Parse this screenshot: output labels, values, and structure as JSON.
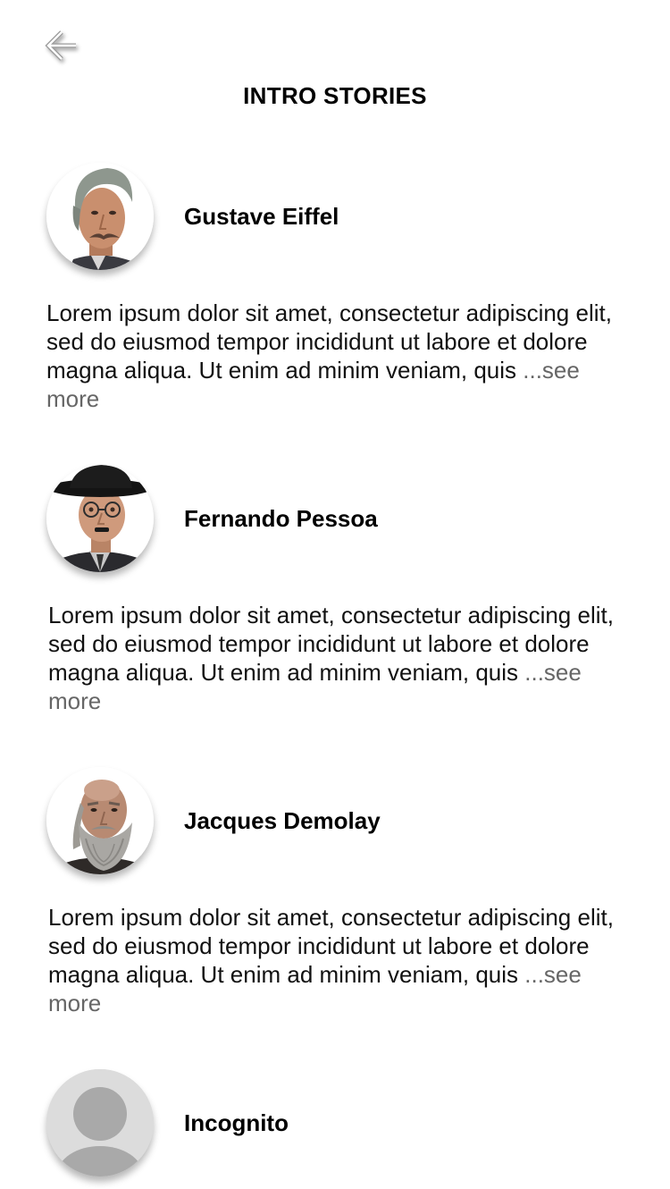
{
  "header": {
    "back_icon": "arrow-left-icon",
    "title": "INTRO STORIES"
  },
  "colors": {
    "background": "#ffffff",
    "text": "#000000",
    "see_more": "#666666",
    "placeholder_avatar": "#dcdcdc"
  },
  "stories": [
    {
      "name": "Gustave Eiffel",
      "avatar": "gustave-eiffel-portrait",
      "text": "Lorem ipsum dolor sit amet, consectetur adipiscing elit, sed do eiusmod tempor incididunt ut labore et dolore magna aliqua. Ut enim ad minim veniam, quis",
      "see_more": "...see more"
    },
    {
      "name": "Fernando Pessoa",
      "avatar": "fernando-pessoa-portrait",
      "text": "Lorem ipsum dolor sit amet, consectetur adipiscing elit, sed do eiusmod tempor incididunt ut labore et dolore magna aliqua. Ut enim ad minim veniam, quis",
      "see_more": "...see more"
    },
    {
      "name": "Jacques Demolay",
      "avatar": "jacques-demolay-portrait",
      "text": "Lorem ipsum dolor sit amet, consectetur adipiscing elit, sed do eiusmod tempor incididunt ut labore et dolore magna aliqua. Ut enim ad minim veniam, quis",
      "see_more": "...see more"
    },
    {
      "name": "Incognito",
      "avatar": "person-placeholder-icon"
    }
  ]
}
